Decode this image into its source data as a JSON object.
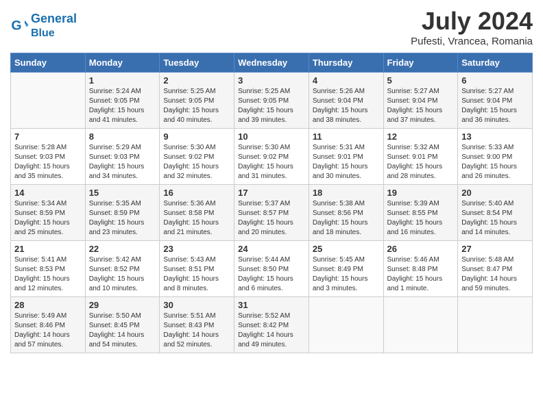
{
  "header": {
    "logo_line1": "General",
    "logo_line2": "Blue",
    "month_year": "July 2024",
    "location": "Pufesti, Vrancea, Romania"
  },
  "weekdays": [
    "Sunday",
    "Monday",
    "Tuesday",
    "Wednesday",
    "Thursday",
    "Friday",
    "Saturday"
  ],
  "weeks": [
    [
      {
        "day": "",
        "info": ""
      },
      {
        "day": "1",
        "info": "Sunrise: 5:24 AM\nSunset: 9:05 PM\nDaylight: 15 hours\nand 41 minutes."
      },
      {
        "day": "2",
        "info": "Sunrise: 5:25 AM\nSunset: 9:05 PM\nDaylight: 15 hours\nand 40 minutes."
      },
      {
        "day": "3",
        "info": "Sunrise: 5:25 AM\nSunset: 9:05 PM\nDaylight: 15 hours\nand 39 minutes."
      },
      {
        "day": "4",
        "info": "Sunrise: 5:26 AM\nSunset: 9:04 PM\nDaylight: 15 hours\nand 38 minutes."
      },
      {
        "day": "5",
        "info": "Sunrise: 5:27 AM\nSunset: 9:04 PM\nDaylight: 15 hours\nand 37 minutes."
      },
      {
        "day": "6",
        "info": "Sunrise: 5:27 AM\nSunset: 9:04 PM\nDaylight: 15 hours\nand 36 minutes."
      }
    ],
    [
      {
        "day": "7",
        "info": "Sunrise: 5:28 AM\nSunset: 9:03 PM\nDaylight: 15 hours\nand 35 minutes."
      },
      {
        "day": "8",
        "info": "Sunrise: 5:29 AM\nSunset: 9:03 PM\nDaylight: 15 hours\nand 34 minutes."
      },
      {
        "day": "9",
        "info": "Sunrise: 5:30 AM\nSunset: 9:02 PM\nDaylight: 15 hours\nand 32 minutes."
      },
      {
        "day": "10",
        "info": "Sunrise: 5:30 AM\nSunset: 9:02 PM\nDaylight: 15 hours\nand 31 minutes."
      },
      {
        "day": "11",
        "info": "Sunrise: 5:31 AM\nSunset: 9:01 PM\nDaylight: 15 hours\nand 30 minutes."
      },
      {
        "day": "12",
        "info": "Sunrise: 5:32 AM\nSunset: 9:01 PM\nDaylight: 15 hours\nand 28 minutes."
      },
      {
        "day": "13",
        "info": "Sunrise: 5:33 AM\nSunset: 9:00 PM\nDaylight: 15 hours\nand 26 minutes."
      }
    ],
    [
      {
        "day": "14",
        "info": "Sunrise: 5:34 AM\nSunset: 8:59 PM\nDaylight: 15 hours\nand 25 minutes."
      },
      {
        "day": "15",
        "info": "Sunrise: 5:35 AM\nSunset: 8:59 PM\nDaylight: 15 hours\nand 23 minutes."
      },
      {
        "day": "16",
        "info": "Sunrise: 5:36 AM\nSunset: 8:58 PM\nDaylight: 15 hours\nand 21 minutes."
      },
      {
        "day": "17",
        "info": "Sunrise: 5:37 AM\nSunset: 8:57 PM\nDaylight: 15 hours\nand 20 minutes."
      },
      {
        "day": "18",
        "info": "Sunrise: 5:38 AM\nSunset: 8:56 PM\nDaylight: 15 hours\nand 18 minutes."
      },
      {
        "day": "19",
        "info": "Sunrise: 5:39 AM\nSunset: 8:55 PM\nDaylight: 15 hours\nand 16 minutes."
      },
      {
        "day": "20",
        "info": "Sunrise: 5:40 AM\nSunset: 8:54 PM\nDaylight: 15 hours\nand 14 minutes."
      }
    ],
    [
      {
        "day": "21",
        "info": "Sunrise: 5:41 AM\nSunset: 8:53 PM\nDaylight: 15 hours\nand 12 minutes."
      },
      {
        "day": "22",
        "info": "Sunrise: 5:42 AM\nSunset: 8:52 PM\nDaylight: 15 hours\nand 10 minutes."
      },
      {
        "day": "23",
        "info": "Sunrise: 5:43 AM\nSunset: 8:51 PM\nDaylight: 15 hours\nand 8 minutes."
      },
      {
        "day": "24",
        "info": "Sunrise: 5:44 AM\nSunset: 8:50 PM\nDaylight: 15 hours\nand 6 minutes."
      },
      {
        "day": "25",
        "info": "Sunrise: 5:45 AM\nSunset: 8:49 PM\nDaylight: 15 hours\nand 3 minutes."
      },
      {
        "day": "26",
        "info": "Sunrise: 5:46 AM\nSunset: 8:48 PM\nDaylight: 15 hours\nand 1 minute."
      },
      {
        "day": "27",
        "info": "Sunrise: 5:48 AM\nSunset: 8:47 PM\nDaylight: 14 hours\nand 59 minutes."
      }
    ],
    [
      {
        "day": "28",
        "info": "Sunrise: 5:49 AM\nSunset: 8:46 PM\nDaylight: 14 hours\nand 57 minutes."
      },
      {
        "day": "29",
        "info": "Sunrise: 5:50 AM\nSunset: 8:45 PM\nDaylight: 14 hours\nand 54 minutes."
      },
      {
        "day": "30",
        "info": "Sunrise: 5:51 AM\nSunset: 8:43 PM\nDaylight: 14 hours\nand 52 minutes."
      },
      {
        "day": "31",
        "info": "Sunrise: 5:52 AM\nSunset: 8:42 PM\nDaylight: 14 hours\nand 49 minutes."
      },
      {
        "day": "",
        "info": ""
      },
      {
        "day": "",
        "info": ""
      },
      {
        "day": "",
        "info": ""
      }
    ]
  ]
}
